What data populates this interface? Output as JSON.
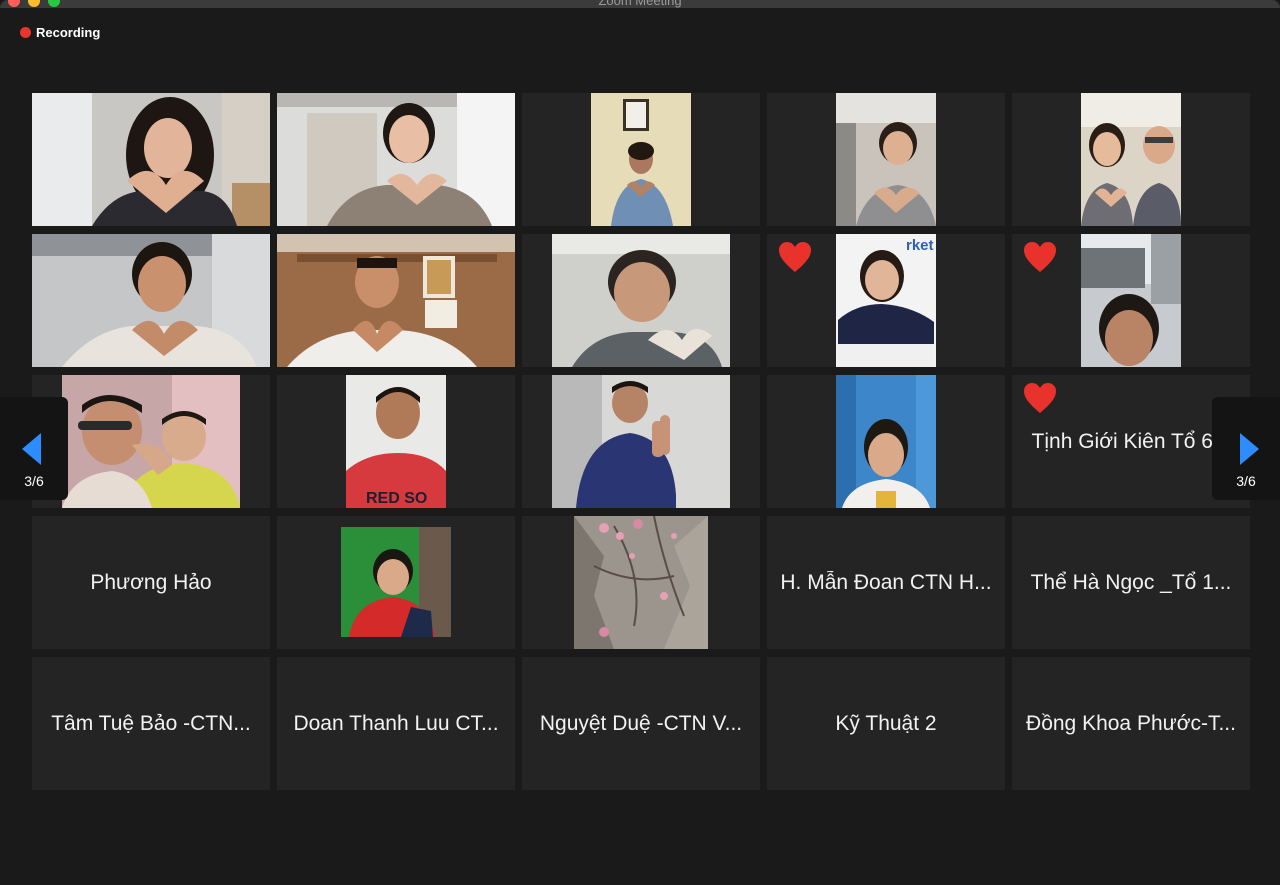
{
  "window": {
    "title": "Zoom Meeting"
  },
  "recording": {
    "label": "Recording",
    "indicator_color": "#e8352e"
  },
  "gallery": {
    "page_indicator_left": "3/6",
    "page_indicator_right": "3/6",
    "arrow_color": "#2d8cff"
  },
  "participants": [
    {
      "kind": "video",
      "name": "",
      "reaction": ""
    },
    {
      "kind": "video",
      "name": "",
      "reaction": ""
    },
    {
      "kind": "video",
      "name": "",
      "reaction": ""
    },
    {
      "kind": "video",
      "name": "",
      "reaction": ""
    },
    {
      "kind": "video",
      "name": "",
      "reaction": ""
    },
    {
      "kind": "video",
      "name": "",
      "reaction": ""
    },
    {
      "kind": "video",
      "name": "",
      "reaction": ""
    },
    {
      "kind": "video",
      "name": "",
      "reaction": ""
    },
    {
      "kind": "video",
      "name": "",
      "reaction": "heart"
    },
    {
      "kind": "video",
      "name": "",
      "reaction": "heart"
    },
    {
      "kind": "video",
      "name": "",
      "reaction": ""
    },
    {
      "kind": "video",
      "name": "",
      "reaction": ""
    },
    {
      "kind": "video",
      "name": "",
      "reaction": ""
    },
    {
      "kind": "video",
      "name": "",
      "reaction": ""
    },
    {
      "kind": "name",
      "name": "Tịnh Giới Kiên Tổ 6...",
      "reaction": "heart"
    },
    {
      "kind": "name",
      "name": "Phương Hảo",
      "reaction": ""
    },
    {
      "kind": "video",
      "name": "",
      "reaction": ""
    },
    {
      "kind": "video",
      "name": "",
      "reaction": ""
    },
    {
      "kind": "name",
      "name": "H. Mẫn Đoan CTN H...",
      "reaction": ""
    },
    {
      "kind": "name",
      "name": "Thể Hà Ngọc _Tổ 1...",
      "reaction": ""
    },
    {
      "kind": "name",
      "name": "Tâm Tuệ Bảo -CTN...",
      "reaction": ""
    },
    {
      "kind": "name",
      "name": "Doan Thanh Luu CT...",
      "reaction": ""
    },
    {
      "kind": "name",
      "name": "Nguyệt Duệ -CTN V...",
      "reaction": ""
    },
    {
      "kind": "name",
      "name": "Kỹ Thuật 2",
      "reaction": ""
    },
    {
      "kind": "name",
      "name": "Đồng Khoa Phước-T...",
      "reaction": ""
    }
  ],
  "reaction_icon": "heart-icon",
  "reaction_color": "#e8322b"
}
